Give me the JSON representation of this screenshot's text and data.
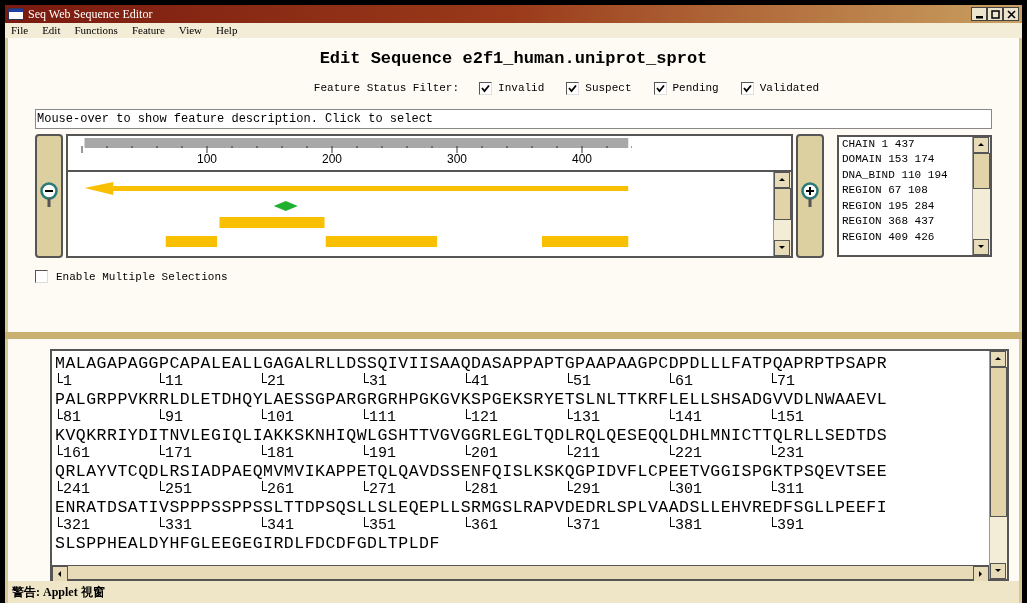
{
  "window": {
    "title": "Seq Web Sequence Editor"
  },
  "menu": [
    "File",
    "Edit",
    "Functions",
    "Feature",
    "View",
    "Help"
  ],
  "heading": "Edit Sequence e2f1_human.uniprot_sprot",
  "filter": {
    "label": "Feature Status Filter:",
    "options": [
      {
        "label": "Invalid",
        "checked": true
      },
      {
        "label": "Suspect",
        "checked": true
      },
      {
        "label": "Pending",
        "checked": true
      },
      {
        "label": "Validated",
        "checked": true
      }
    ]
  },
  "description": "Mouse-over to show feature description. Click to select",
  "ruler": {
    "labels": [
      "100",
      "200",
      "300",
      "400"
    ]
  },
  "features": [
    "CHAIN 1 437",
    "DOMAIN 153 174",
    "DNA_BIND 110 194",
    "REGION 67 108",
    "REGION 195 284",
    "REGION 368 437",
    "REGION 409 426"
  ],
  "multiple_selections": {
    "label": "Enable Multiple Selections",
    "checked": false
  },
  "sequence": [
    {
      "residues": "MALAGAPAGGPCAPALEALLGAGALRLLDSSQIVIISAAQDASAPPAPTGPAAPAAGPCDPDLLLFATPQAPRPTPSAPR",
      "positions": [
        "1",
        "11",
        "21",
        "31",
        "41",
        "51",
        "61",
        "71"
      ]
    },
    {
      "residues": "PALGRPPVKRRLDLETDHQYLAESSGPARGRGRHPGKGVKSPGEKSRYETSLNLTTKRFLELLSHSADGVVDLNWAAEVL",
      "positions": [
        "81",
        "91",
        "101",
        "111",
        "121",
        "131",
        "141",
        "151"
      ]
    },
    {
      "residues": "KVQKRRIYDITNVLEGIQLIAKKSKNHIQWLGSHTTVGVGGRLEGLTQDLRQLQESEQQLDHLMNICTTQLRLLSEDTDS",
      "positions": [
        "161",
        "171",
        "181",
        "191",
        "201",
        "211",
        "221",
        "231"
      ]
    },
    {
      "residues": "QRLAYVTCQDLRSIADPAEQMVMVIKAPPETQLQAVDSSENFQISLKSKQGPIDVFLCPEETVGGISPGKTPSQEVTSEE",
      "positions": [
        "241",
        "251",
        "261",
        "271",
        "281",
        "291",
        "301",
        "311"
      ]
    },
    {
      "residues": "ENRATDSATIVSPPPSSPPSSLTTDPSQSLLSLEQEPLLSRMGSLRAPVDEDRLSPLVAADSLLEHVREDFSGLLPEEFI",
      "positions": [
        "321",
        "331",
        "341",
        "351",
        "361",
        "371",
        "381",
        "391"
      ]
    },
    {
      "residues": "SLSPPHEALDYHFGLEEGEGIRDLFDCDFGDLTPLDF"
    }
  ],
  "status_bar": "警告: Applet 視窗"
}
